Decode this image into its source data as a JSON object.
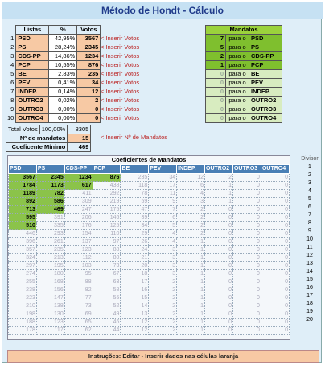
{
  "title": "Método de Hondt - Cálculo",
  "votes_table": {
    "headers": [
      "Listas",
      "%",
      "Votos"
    ],
    "rows": [
      {
        "n": "1",
        "party": "PSD",
        "pct": "42,95%",
        "votes": "3567"
      },
      {
        "n": "2",
        "party": "PS",
        "pct": "28,24%",
        "votes": "2345"
      },
      {
        "n": "3",
        "party": "CDS-PP",
        "pct": "14,86%",
        "votes": "1234"
      },
      {
        "n": "4",
        "party": "PCP",
        "pct": "10,55%",
        "votes": "876"
      },
      {
        "n": "5",
        "party": "BE",
        "pct": "2,83%",
        "votes": "235"
      },
      {
        "n": "6",
        "party": "PEV",
        "pct": "0,41%",
        "votes": "34"
      },
      {
        "n": "7",
        "party": "INDEP.",
        "pct": "0,14%",
        "votes": "12"
      },
      {
        "n": "8",
        "party": "OUTRO2",
        "pct": "0,02%",
        "votes": "2"
      },
      {
        "n": "9",
        "party": "OUTRO3",
        "pct": "0,00%",
        "votes": "0"
      },
      {
        "n": "10",
        "party": "OUTRO4",
        "pct": "0,00%",
        "votes": "0"
      }
    ],
    "insert_votes_label": "< Inserir Votos"
  },
  "mandates": {
    "header": "Mandatos",
    "para": "para o",
    "rows": [
      {
        "v": "7",
        "party": "PSD",
        "hl": true
      },
      {
        "v": "5",
        "party": "PS",
        "hl": true
      },
      {
        "v": "2",
        "party": "CDS-PP",
        "hl": true
      },
      {
        "v": "1",
        "party": "PCP",
        "hl": true
      },
      {
        "v": "0",
        "party": "BE",
        "hl": false
      },
      {
        "v": "0",
        "party": "PEV",
        "hl": false
      },
      {
        "v": "0",
        "party": "INDEP.",
        "hl": false
      },
      {
        "v": "0",
        "party": "OUTRO2",
        "hl": false
      },
      {
        "v": "0",
        "party": "OUTRO3",
        "hl": false
      },
      {
        "v": "0",
        "party": "OUTRO4",
        "hl": false
      }
    ]
  },
  "totals": {
    "total_label": "Total Votos",
    "total_pct": "100,00%",
    "total_votes": "8305",
    "mandates_label": "Nº de mandatos",
    "mandates_value": "15",
    "mandates_insert": "< Inserir Nº de Mandatos",
    "coef_label": "Coeficente Mínimo",
    "coef_value": "469"
  },
  "coef_table": {
    "title": "Coeficientes de Mandatos",
    "headers": [
      "PSD",
      "PS",
      "CDS-PP",
      "PCP",
      "BE",
      "PEV",
      "INDEP.",
      "OUTRO2",
      "OUTRO3",
      "OUTRO4"
    ],
    "rows": [
      [
        "3567",
        "2345",
        "1234",
        "876",
        "235",
        "34",
        "12",
        "2",
        "0",
        "0"
      ],
      [
        "1784",
        "1173",
        "617",
        "438",
        "118",
        "17",
        "6",
        "1",
        "0",
        "0"
      ],
      [
        "1189",
        "782",
        "411",
        "292",
        "78",
        "11",
        "4",
        "1",
        "0",
        "0"
      ],
      [
        "892",
        "586",
        "309",
        "219",
        "59",
        "9",
        "3",
        "1",
        "0",
        "0"
      ],
      [
        "713",
        "469",
        "247",
        "175",
        "47",
        "7",
        "2",
        "0",
        "0",
        "0"
      ],
      [
        "595",
        "391",
        "206",
        "146",
        "39",
        "6",
        "2",
        "0",
        "0",
        "0"
      ],
      [
        "510",
        "335",
        "176",
        "125",
        "34",
        "5",
        "2",
        "0",
        "0",
        "0"
      ],
      [
        "446",
        "293",
        "154",
        "110",
        "29",
        "4",
        "2",
        "0",
        "0",
        "0"
      ],
      [
        "396",
        "261",
        "137",
        "97",
        "26",
        "4",
        "1",
        "0",
        "0",
        "0"
      ],
      [
        "357",
        "235",
        "123",
        "88",
        "24",
        "3",
        "1",
        "0",
        "0",
        "0"
      ],
      [
        "324",
        "213",
        "112",
        "80",
        "21",
        "3",
        "1",
        "0",
        "0",
        "0"
      ],
      [
        "297",
        "195",
        "103",
        "73",
        "20",
        "3",
        "1",
        "0",
        "0",
        "0"
      ],
      [
        "274",
        "180",
        "95",
        "67",
        "18",
        "3",
        "1",
        "0",
        "0",
        "0"
      ],
      [
        "255",
        "168",
        "88",
        "63",
        "17",
        "2",
        "1",
        "0",
        "0",
        "0"
      ],
      [
        "238",
        "156",
        "82",
        "58",
        "16",
        "2",
        "1",
        "0",
        "0",
        "0"
      ],
      [
        "223",
        "147",
        "77",
        "55",
        "15",
        "2",
        "1",
        "0",
        "0",
        "0"
      ],
      [
        "210",
        "138",
        "73",
        "52",
        "14",
        "2",
        "1",
        "0",
        "0",
        "0"
      ],
      [
        "198",
        "130",
        "69",
        "49",
        "13",
        "2",
        "1",
        "0",
        "0",
        "0"
      ],
      [
        "188",
        "123",
        "65",
        "46",
        "12",
        "2",
        "1",
        "0",
        "0",
        "0"
      ],
      [
        "178",
        "117",
        "62",
        "44",
        "12",
        "2",
        "1",
        "0",
        "0",
        "0"
      ]
    ],
    "highlighted": [
      [
        0,
        0
      ],
      [
        0,
        1
      ],
      [
        0,
        2
      ],
      [
        0,
        3
      ],
      [
        1,
        0
      ],
      [
        1,
        1
      ],
      [
        1,
        2
      ],
      [
        2,
        0
      ],
      [
        2,
        1
      ],
      [
        3,
        0
      ],
      [
        3,
        1
      ],
      [
        4,
        0
      ],
      [
        4,
        1
      ],
      [
        5,
        0
      ],
      [
        6,
        0
      ]
    ]
  },
  "divisor": {
    "label": "Divisor",
    "values": [
      "1",
      "2",
      "3",
      "4",
      "5",
      "6",
      "7",
      "8",
      "9",
      "10",
      "11",
      "12",
      "13",
      "14",
      "15",
      "16",
      "17",
      "18",
      "19",
      "20"
    ]
  },
  "footer": "Instruções: Editar - Inserir dados nas células laranja"
}
